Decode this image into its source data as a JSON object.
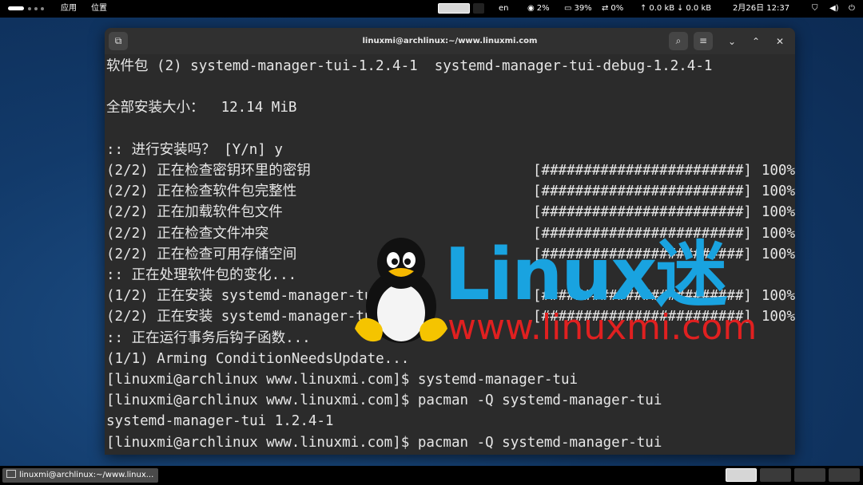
{
  "topbar": {
    "menu_apps": "应用",
    "menu_places": "位置",
    "input_method": "en",
    "cpu": "2%",
    "memory": "39%",
    "swap": "0%",
    "net_up": "0.0 kB",
    "net_down": "0.0 kB",
    "datetime": "2月26日  12:37"
  },
  "window": {
    "title": "linuxmi@archlinux:~/www.linuxmi.com"
  },
  "terminal": {
    "lines": [
      "软件包 (2) systemd-manager-tui-1.2.4-1  systemd-manager-tui-debug-1.2.4-1",
      "",
      "全部安装大小：  12.14 MiB",
      "",
      ":: 进行安装吗？ [Y/n] y",
      "(2/2) 正在检查密钥环里的密钥",
      "(2/2) 正在检查软件包完整性",
      "(2/2) 正在加载软件包文件",
      "(2/2) 正在检查文件冲突",
      "(2/2) 正在检查可用存储空间",
      ":: 正在处理软件包的变化...",
      "(1/2) 正在安装 systemd-manager-tui",
      "(2/2) 正在安装 systemd-manager-tui-debug",
      ":: 正在运行事务后钩子函数...",
      "(1/1) Arming ConditionNeedsUpdate...",
      "[linuxmi@archlinux www.linuxmi.com]$ systemd-manager-tui",
      "[linuxmi@archlinux www.linuxmi.com]$ pacman -Q systemd-manager-tui",
      "systemd-manager-tui 1.2.4-1",
      "[linuxmi@archlinux www.linuxmi.com]$ pacman -Q systemd-manager-tui"
    ],
    "progress_bar": "[########################]",
    "progress_pct": "100%",
    "progress_rows": [
      5,
      6,
      7,
      8,
      9,
      11,
      12
    ]
  },
  "watermark": {
    "brand": "Linux迷",
    "url": "www.linuxmi.com"
  },
  "taskbar": {
    "task_label": "linuxmi@archlinux:~/www.linux..."
  }
}
